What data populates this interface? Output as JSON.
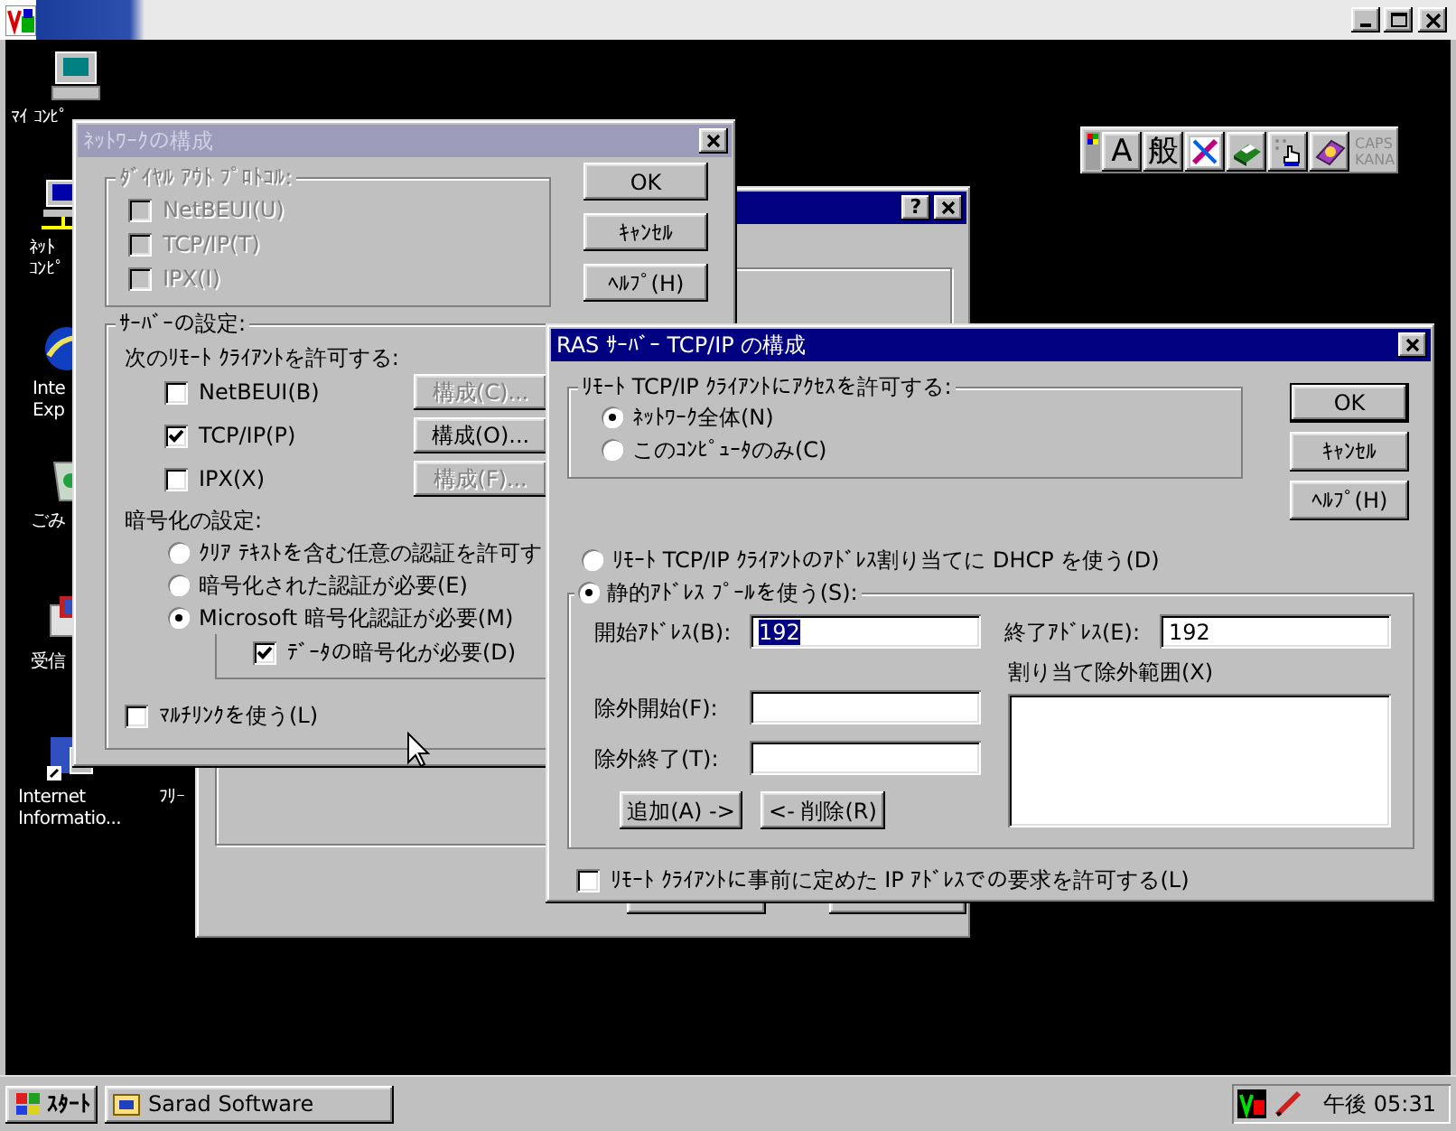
{
  "desktop_icons": [
    {
      "kind": "computer",
      "lines": [
        "ﾏｲ ｺﾝﾋﾟ"
      ]
    },
    {
      "kind": "network",
      "lines": [
        "ﾈｯﾄ",
        "ｺﾝﾋﾟ"
      ]
    },
    {
      "kind": "browser",
      "lines": [
        "Inte",
        "Exp"
      ]
    },
    {
      "kind": "trash",
      "lines": [
        "ごみ"
      ]
    },
    {
      "kind": "inbox",
      "lines": [
        "受信"
      ]
    },
    {
      "kind": "server",
      "lines": [
        "Internet",
        "Informatio..."
      ]
    },
    {
      "kind": "folder",
      "lines": [
        "ﾌﾘｰ"
      ]
    }
  ],
  "ime_toolbar": {
    "keys": [
      {
        "kind": "text",
        "label": "A"
      },
      {
        "kind": "text",
        "label": "般"
      },
      {
        "kind": "pen"
      },
      {
        "kind": "book"
      },
      {
        "kind": "pointer"
      },
      {
        "kind": "help"
      }
    ],
    "indicators": [
      "CAPS",
      "KANA"
    ]
  },
  "back_dialog": {
    "help_label": "?"
  },
  "network_dialog": {
    "title": "ﾈｯﾄﾜｰｸの構成",
    "active": false,
    "dialout": {
      "label": "ﾀﾞｲﾔﾙ ｱｳﾄ ﾌﾟﾛﾄｺﾙ:",
      "disabled": true,
      "options": [
        {
          "label": "NetBEUI(U)",
          "checked": false
        },
        {
          "label": "TCP/IP(T)",
          "checked": false
        },
        {
          "label": "IPX(I)",
          "checked": false
        }
      ]
    },
    "buttons": [
      "OK",
      "ｷｬﾝｾﾙ",
      "ﾍﾙﾌﾟ(H)"
    ],
    "server": {
      "label": "ｻｰﾊﾞｰの設定:",
      "allow_label": "次のﾘﾓｰﾄ ｸﾗｲｱﾝﾄを許可する:",
      "protocols": [
        {
          "label": "NetBEUI(B)",
          "checked": false,
          "button": "構成(C)...",
          "disabled": true
        },
        {
          "label": "TCP/IP(P)",
          "checked": true,
          "button": "構成(O)...",
          "disabled": false
        },
        {
          "label": "IPX(X)",
          "checked": false,
          "button": "構成(F)...",
          "disabled": true
        }
      ],
      "encryption_label": "暗号化の設定:",
      "encryption": [
        {
          "label": "ｸﾘｱ ﾃｷｽﾄを含む任意の認証を許可す",
          "selected": false
        },
        {
          "label": "暗号化された認証が必要(E)",
          "selected": false
        },
        {
          "label": "Microsoft 暗号化認証が必要(M)",
          "selected": true
        }
      ],
      "data_encryption": {
        "label": "ﾃﾞｰﾀの暗号化が必要(D)",
        "checked": true
      },
      "multilink": {
        "label": "ﾏﾙﾁﾘﾝｸを使う(L)",
        "checked": false
      }
    }
  },
  "ras_dialog": {
    "title": "RAS ｻｰﾊﾞｰ TCP/IP の構成",
    "active": true,
    "access": {
      "label": "ﾘﾓｰﾄ TCP/IP ｸﾗｲｱﾝﾄにｱｸｾｽを許可する:",
      "options": [
        {
          "label": "ﾈｯﾄﾜｰｸ全体(N)",
          "selected": true
        },
        {
          "label": "このｺﾝﾋﾟｭｰﾀのみ(C)",
          "selected": false
        }
      ]
    },
    "buttons": [
      {
        "label": "OK",
        "default": true
      },
      {
        "label": "ｷｬﾝｾﾙ",
        "default": false
      },
      {
        "label": "ﾍﾙﾌﾟ(H)",
        "default": false
      }
    ],
    "dhcp": {
      "label": "ﾘﾓｰﾄ TCP/IP ｸﾗｲｱﾝﾄのｱﾄﾞﾚｽ割り当てに DHCP を使う(D)",
      "selected": false
    },
    "static": {
      "label": "静的ｱﾄﾞﾚｽ ﾌﾟｰﾙを使う(S):",
      "selected": true,
      "start": {
        "label": "開始ｱﾄﾞﾚｽ(B):",
        "value": "192",
        "selected": true
      },
      "end": {
        "label": "終了ｱﾄﾞﾚｽ(E):",
        "value": "192",
        "selected": false
      },
      "exclude_start": {
        "label": "除外開始(F):"
      },
      "exclude_end": {
        "label": "除外終了(T):"
      },
      "add_button": "追加(A) ->",
      "remove_button": "<- 削除(R)",
      "excluded_label": "割り当て除外範囲(X)"
    },
    "client_request": {
      "label": "ﾘﾓｰﾄ ｸﾗｲｱﾝﾄに事前に定めた IP ｱﾄﾞﾚｽでの要求を許可する(L)",
      "checked": false
    }
  },
  "taskbar": {
    "start": "ｽﾀｰﾄ",
    "tasks": [
      {
        "label": "Sarad Software",
        "selected": false
      }
    ],
    "clock": "午後 05:31"
  }
}
